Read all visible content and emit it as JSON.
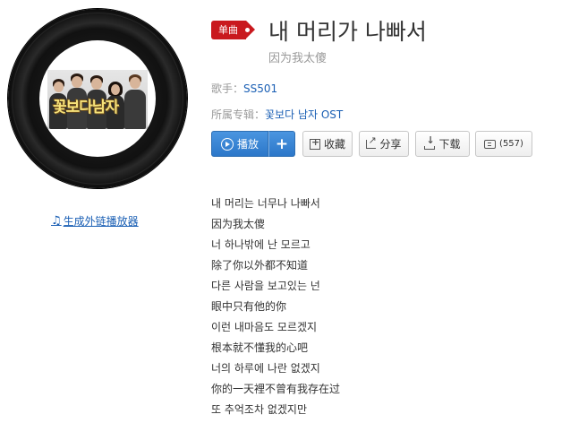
{
  "album": {
    "cover_title": "꽃보다남자",
    "external_player_link": "生成外链播放器"
  },
  "song": {
    "badge": "单曲",
    "title": "내 머리가 나빠서",
    "subtitle": "因为我太傻",
    "artist_label": "歌手：",
    "artist": "SS501",
    "album_label": "所属专辑：",
    "album": "꽃보다 남자 OST"
  },
  "actions": {
    "play": "播放",
    "add": "+",
    "favorite": "收藏",
    "share": "分享",
    "download": "下载",
    "comment_count": "(557)"
  },
  "lyrics": [
    "내 머리는 너무나 나빠서",
    "因为我太傻",
    "너 하나밖에 난 모르고",
    "除了你以外都不知道",
    "다른 사람을 보고있는 넌",
    "眼中只有他的你",
    "이런 내마음도 모르겠지",
    "根本就不懂我的心吧",
    "너의 하루에 나란 없겠지",
    "你的一天裡不曾有我存在过",
    "또 추억조차 없겠지만"
  ],
  "colors": {
    "badge": "#c9191e",
    "link": "#1a5fb4",
    "play_button": "#2c77c9"
  }
}
